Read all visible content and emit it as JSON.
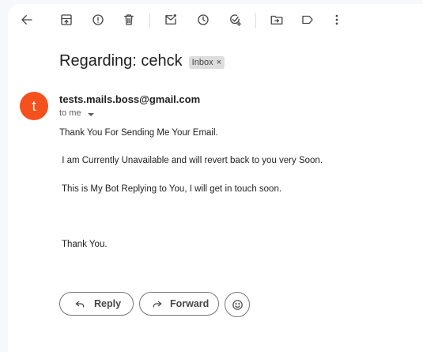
{
  "email": {
    "subject": "Regarding: cehck",
    "label": "Inbox",
    "label_remove": "×",
    "avatar_letter": "t",
    "sender": "tests.mails.boss@gmail.com",
    "recipient": "to me",
    "body_lines": [
      "Thank You For Sending Me Your Email.",
      " I am Currently Unavailable and will revert back to you very Soon.",
      " This is My Bot Replying to You, I will get in touch soon.",
      " Thank You."
    ]
  },
  "actions": {
    "reply_label": "Reply",
    "forward_label": "Forward"
  },
  "colors": {
    "avatar": "#f4511e",
    "background": "#f6f8fc",
    "panel": "#ffffff"
  }
}
